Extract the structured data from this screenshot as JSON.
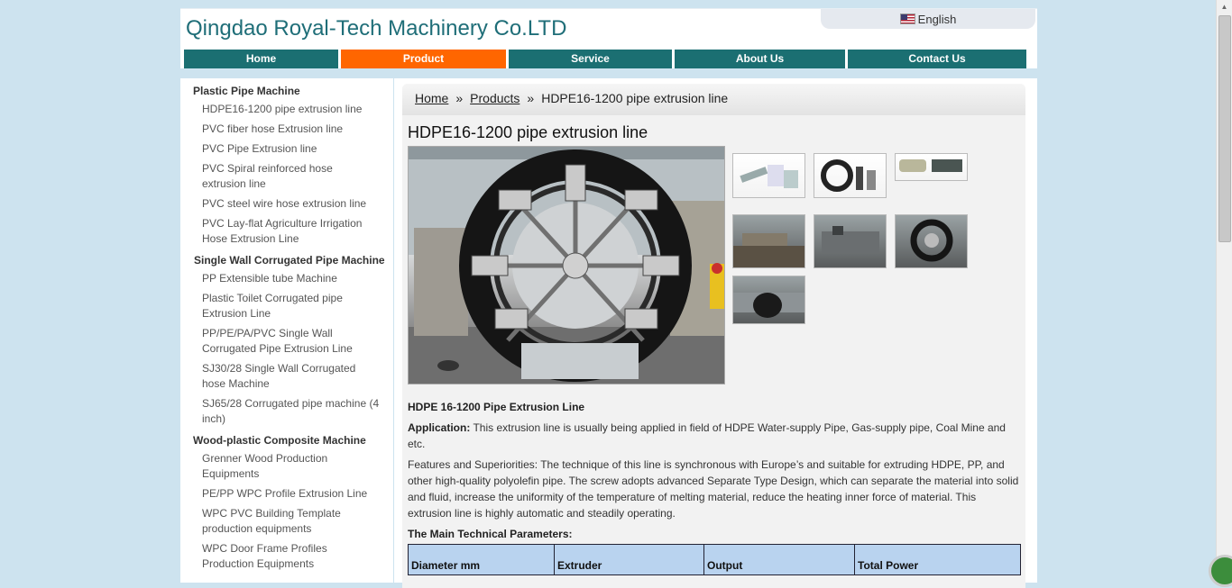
{
  "header": {
    "company_name": "Qingdao Royal-Tech Machinery Co.LTD",
    "language": "English"
  },
  "nav": {
    "items": [
      {
        "label": "Home"
      },
      {
        "label": "Product"
      },
      {
        "label": "Service"
      },
      {
        "label": "About Us"
      },
      {
        "label": "Contact Us"
      }
    ],
    "active": "Product"
  },
  "sidebar": {
    "groups": [
      {
        "title": "Plastic Pipe Machine",
        "items": [
          "HDPE16-1200 pipe extrusion line",
          "PVC fiber hose Extrusion line",
          "PVC Pipe Extrusion line",
          "PVC Spiral reinforced hose extrusion line",
          "PVC steel wire hose extrusion line",
          "PVC Lay-flat Agriculture Irrigation Hose Extrusion Line"
        ]
      },
      {
        "title": "Single Wall Corrugated Pipe Machine",
        "items": [
          "PP Extensible tube Machine",
          "Plastic Toilet Corrugated pipe Extrusion Line",
          "PP/PE/PA/PVC Single Wall Corrugated Pipe Extrusion Line",
          "SJ30/28 Single Wall Corrugated hose Machine",
          "SJ65/28 Corrugated pipe machine (4 inch)"
        ]
      },
      {
        "title": "Wood-plastic Composite Machine",
        "items": [
          "Grenner Wood Production Equipments",
          "PE/PP WPC Profile Extrusion Line",
          "WPC PVC Building Template production equipments",
          "WPC Door Frame Profiles Production Equipments"
        ]
      }
    ]
  },
  "breadcrumb": {
    "home": "Home",
    "separator": "»",
    "products": "Products",
    "current": "HDPE16-1200 pipe extrusion line"
  },
  "product": {
    "title": "HDPE16-1200 pipe extrusion line",
    "subtitle": "HDPE 16-1200 Pipe Extrusion Line",
    "application_label": "Application:",
    "application_text": "This extrusion line is usually being applied in field of HDPE Water-supply Pipe, Gas-supply pipe, Coal Mine and etc.",
    "features_text": "Features and Superiorities: The technique of this line is synchronous with Europe’s and suitable for extruding HDPE, PP, and other high-quality polyolefin pipe. The screw adopts advanced Separate Type Design, which can separate the material into solid and fluid, increase the uniformity of the temperature of melting material, reduce the heating inner force of material. This extrusion line is highly automatic and steadily operating.",
    "params_heading": "The Main Technical Parameters:",
    "table_headers": [
      "Diameter mm",
      "Extruder",
      "Output",
      "Total Power"
    ]
  },
  "colors": {
    "nav_bg": "#1b6f72",
    "nav_active": "#ff6600",
    "logo_text": "#1f6e78",
    "page_bg": "#cde3ef",
    "table_header": "#b9d3ef"
  }
}
